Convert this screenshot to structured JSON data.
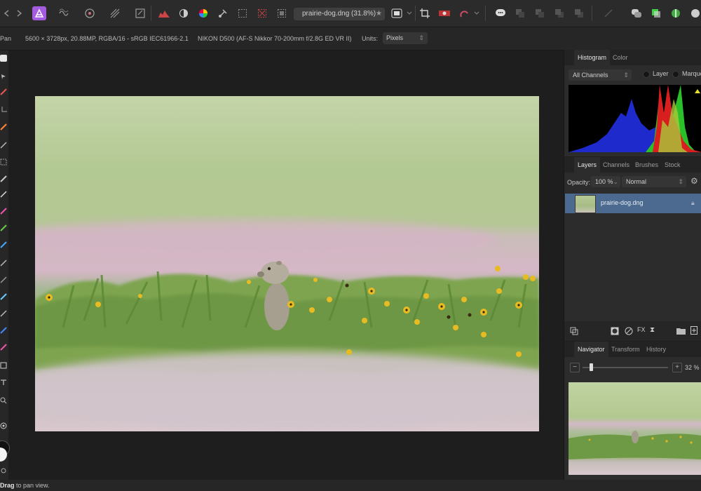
{
  "toolbar": {
    "document_tab": "prairie-dog.dng (31.8%)",
    "star": "★",
    "icons": [
      "affinity-photo-logo-icon",
      "persona-liquify-icon",
      "persona-develop-icon",
      "persona-tonemapping-icon",
      "persona-export-icon",
      "histogram-icon",
      "contrast-icon",
      "color-wheel-icon",
      "selection-brush-icon",
      "marquee-icon",
      "snapping-icon",
      "transparency-icon",
      "view-mode-icon",
      "crop-icon",
      "quickmask-icon",
      "refine-icon",
      "assistant-icon",
      "arrange-icon",
      "studio-icon",
      "color-picker-icon"
    ]
  },
  "context": {
    "tool_name": "Pan",
    "dimensions": "5600 × 3728px, 20.88MP, RGBA/16 - sRGB IEC61966-2.1",
    "camera": "NIKON D500 (AF-S Nikkor 70-200mm f/2.8G ED VR II)",
    "units_label": "Units:",
    "units_value": "Pixels"
  },
  "histogram_panel": {
    "tabs": [
      "Histogram",
      "Color"
    ],
    "channel_select": "All Channels",
    "option_layer": "Layer",
    "option_marquee": "Marquee"
  },
  "layers_panel": {
    "tabs": [
      "Layers",
      "Channels",
      "Brushes",
      "Stock"
    ],
    "opacity_label": "Opacity:",
    "opacity_value": "100 %",
    "blend_mode": "Normal",
    "layer_name": "prairie-dog.dng"
  },
  "navigator_panel": {
    "tabs": [
      "Navigator",
      "Transform",
      "History"
    ],
    "zoom_value": "32 %",
    "minus": "−",
    "plus": "+"
  },
  "status": {
    "bold": "Drag",
    "text": " to pan view."
  },
  "colors": {
    "accent": "#a45be0",
    "selection": "#4c6a8f"
  }
}
